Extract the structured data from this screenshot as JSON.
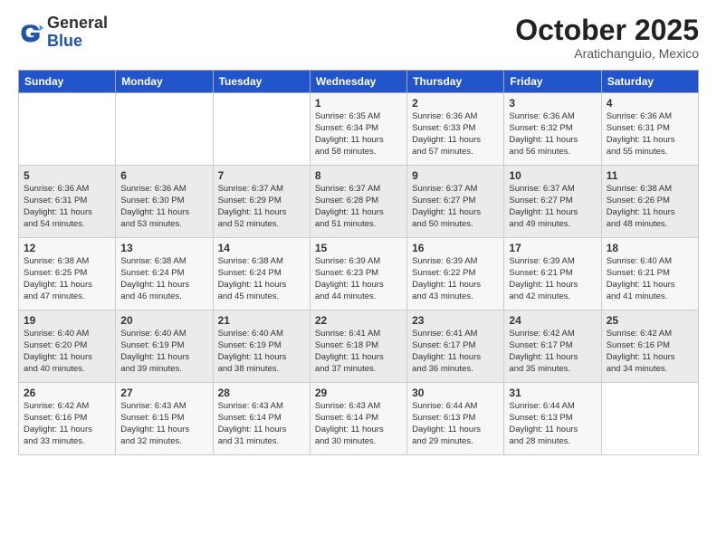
{
  "logo": {
    "general": "General",
    "blue": "Blue"
  },
  "header": {
    "month": "October 2025",
    "location": "Aratichanguio, Mexico"
  },
  "weekdays": [
    "Sunday",
    "Monday",
    "Tuesday",
    "Wednesday",
    "Thursday",
    "Friday",
    "Saturday"
  ],
  "weeks": [
    [
      {
        "day": "",
        "info": ""
      },
      {
        "day": "",
        "info": ""
      },
      {
        "day": "",
        "info": ""
      },
      {
        "day": "1",
        "info": "Sunrise: 6:35 AM\nSunset: 6:34 PM\nDaylight: 11 hours\nand 58 minutes."
      },
      {
        "day": "2",
        "info": "Sunrise: 6:36 AM\nSunset: 6:33 PM\nDaylight: 11 hours\nand 57 minutes."
      },
      {
        "day": "3",
        "info": "Sunrise: 6:36 AM\nSunset: 6:32 PM\nDaylight: 11 hours\nand 56 minutes."
      },
      {
        "day": "4",
        "info": "Sunrise: 6:36 AM\nSunset: 6:31 PM\nDaylight: 11 hours\nand 55 minutes."
      }
    ],
    [
      {
        "day": "5",
        "info": "Sunrise: 6:36 AM\nSunset: 6:31 PM\nDaylight: 11 hours\nand 54 minutes."
      },
      {
        "day": "6",
        "info": "Sunrise: 6:36 AM\nSunset: 6:30 PM\nDaylight: 11 hours\nand 53 minutes."
      },
      {
        "day": "7",
        "info": "Sunrise: 6:37 AM\nSunset: 6:29 PM\nDaylight: 11 hours\nand 52 minutes."
      },
      {
        "day": "8",
        "info": "Sunrise: 6:37 AM\nSunset: 6:28 PM\nDaylight: 11 hours\nand 51 minutes."
      },
      {
        "day": "9",
        "info": "Sunrise: 6:37 AM\nSunset: 6:27 PM\nDaylight: 11 hours\nand 50 minutes."
      },
      {
        "day": "10",
        "info": "Sunrise: 6:37 AM\nSunset: 6:27 PM\nDaylight: 11 hours\nand 49 minutes."
      },
      {
        "day": "11",
        "info": "Sunrise: 6:38 AM\nSunset: 6:26 PM\nDaylight: 11 hours\nand 48 minutes."
      }
    ],
    [
      {
        "day": "12",
        "info": "Sunrise: 6:38 AM\nSunset: 6:25 PM\nDaylight: 11 hours\nand 47 minutes."
      },
      {
        "day": "13",
        "info": "Sunrise: 6:38 AM\nSunset: 6:24 PM\nDaylight: 11 hours\nand 46 minutes."
      },
      {
        "day": "14",
        "info": "Sunrise: 6:38 AM\nSunset: 6:24 PM\nDaylight: 11 hours\nand 45 minutes."
      },
      {
        "day": "15",
        "info": "Sunrise: 6:39 AM\nSunset: 6:23 PM\nDaylight: 11 hours\nand 44 minutes."
      },
      {
        "day": "16",
        "info": "Sunrise: 6:39 AM\nSunset: 6:22 PM\nDaylight: 11 hours\nand 43 minutes."
      },
      {
        "day": "17",
        "info": "Sunrise: 6:39 AM\nSunset: 6:21 PM\nDaylight: 11 hours\nand 42 minutes."
      },
      {
        "day": "18",
        "info": "Sunrise: 6:40 AM\nSunset: 6:21 PM\nDaylight: 11 hours\nand 41 minutes."
      }
    ],
    [
      {
        "day": "19",
        "info": "Sunrise: 6:40 AM\nSunset: 6:20 PM\nDaylight: 11 hours\nand 40 minutes."
      },
      {
        "day": "20",
        "info": "Sunrise: 6:40 AM\nSunset: 6:19 PM\nDaylight: 11 hours\nand 39 minutes."
      },
      {
        "day": "21",
        "info": "Sunrise: 6:40 AM\nSunset: 6:19 PM\nDaylight: 11 hours\nand 38 minutes."
      },
      {
        "day": "22",
        "info": "Sunrise: 6:41 AM\nSunset: 6:18 PM\nDaylight: 11 hours\nand 37 minutes."
      },
      {
        "day": "23",
        "info": "Sunrise: 6:41 AM\nSunset: 6:17 PM\nDaylight: 11 hours\nand 36 minutes."
      },
      {
        "day": "24",
        "info": "Sunrise: 6:42 AM\nSunset: 6:17 PM\nDaylight: 11 hours\nand 35 minutes."
      },
      {
        "day": "25",
        "info": "Sunrise: 6:42 AM\nSunset: 6:16 PM\nDaylight: 11 hours\nand 34 minutes."
      }
    ],
    [
      {
        "day": "26",
        "info": "Sunrise: 6:42 AM\nSunset: 6:16 PM\nDaylight: 11 hours\nand 33 minutes."
      },
      {
        "day": "27",
        "info": "Sunrise: 6:43 AM\nSunset: 6:15 PM\nDaylight: 11 hours\nand 32 minutes."
      },
      {
        "day": "28",
        "info": "Sunrise: 6:43 AM\nSunset: 6:14 PM\nDaylight: 11 hours\nand 31 minutes."
      },
      {
        "day": "29",
        "info": "Sunrise: 6:43 AM\nSunset: 6:14 PM\nDaylight: 11 hours\nand 30 minutes."
      },
      {
        "day": "30",
        "info": "Sunrise: 6:44 AM\nSunset: 6:13 PM\nDaylight: 11 hours\nand 29 minutes."
      },
      {
        "day": "31",
        "info": "Sunrise: 6:44 AM\nSunset: 6:13 PM\nDaylight: 11 hours\nand 28 minutes."
      },
      {
        "day": "",
        "info": ""
      }
    ]
  ]
}
